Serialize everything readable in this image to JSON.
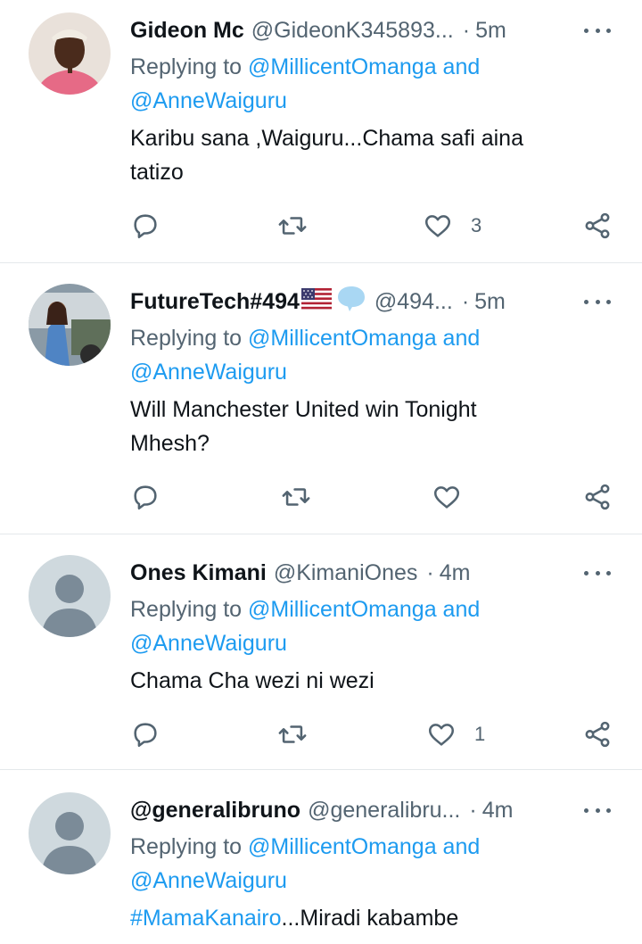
{
  "tweets": [
    {
      "name": "Gideon Mc",
      "handle": "@GideonK345893...",
      "separator": "·",
      "time": "5m",
      "replying_prefix": "Replying to",
      "replying_mention1": "@MillicentOmanga",
      "replying_and": "and",
      "replying_mention2": "@AnneWaiguru",
      "text_line1": "Karibu sana ,Waiguru...Chama safi aina",
      "text_line2": "tatizo",
      "like_count": "3"
    },
    {
      "name": "FutureTech#494",
      "handle": "@494...",
      "separator": "·",
      "time": "5m",
      "replying_prefix": "Replying to",
      "replying_mention1": "@MillicentOmanga",
      "replying_and": "and",
      "replying_mention2": "@AnneWaiguru",
      "text_line1": "Will Manchester United win Tonight",
      "text_line2": "Mhesh?",
      "like_count": ""
    },
    {
      "name": "Ones Kimani",
      "handle": "@KimaniOnes",
      "separator": "·",
      "time": "4m",
      "replying_prefix": "Replying to",
      "replying_mention1": "@MillicentOmanga",
      "replying_and": "and",
      "replying_mention2": "@AnneWaiguru",
      "text_line1": "Chama Cha wezi ni wezi",
      "like_count": "1"
    },
    {
      "name": "@generalibruno",
      "handle": "@generalibru...",
      "separator": "·",
      "time": "4m",
      "replying_prefix": "Replying to",
      "replying_mention1": "@MillicentOmanga",
      "replying_and": "and",
      "replying_mention2": "@AnneWaiguru",
      "text_hashtag": "#MamaKanairo",
      "text_rest": "...Miradi kabambe"
    }
  ],
  "icons": {
    "reply": "reply-icon",
    "retweet": "retweet-icon",
    "like": "heart-icon",
    "share": "share-icon",
    "more": "more-icon",
    "flag": "us-flag-icon",
    "speech": "speech-bubble-icon"
  },
  "colors": {
    "link": "#1d9bf0",
    "secondary_text": "#536471",
    "divider": "#e4e8eb",
    "default_avatar_bg": "#cfd9de",
    "default_avatar_fg": "#7b8b98"
  }
}
